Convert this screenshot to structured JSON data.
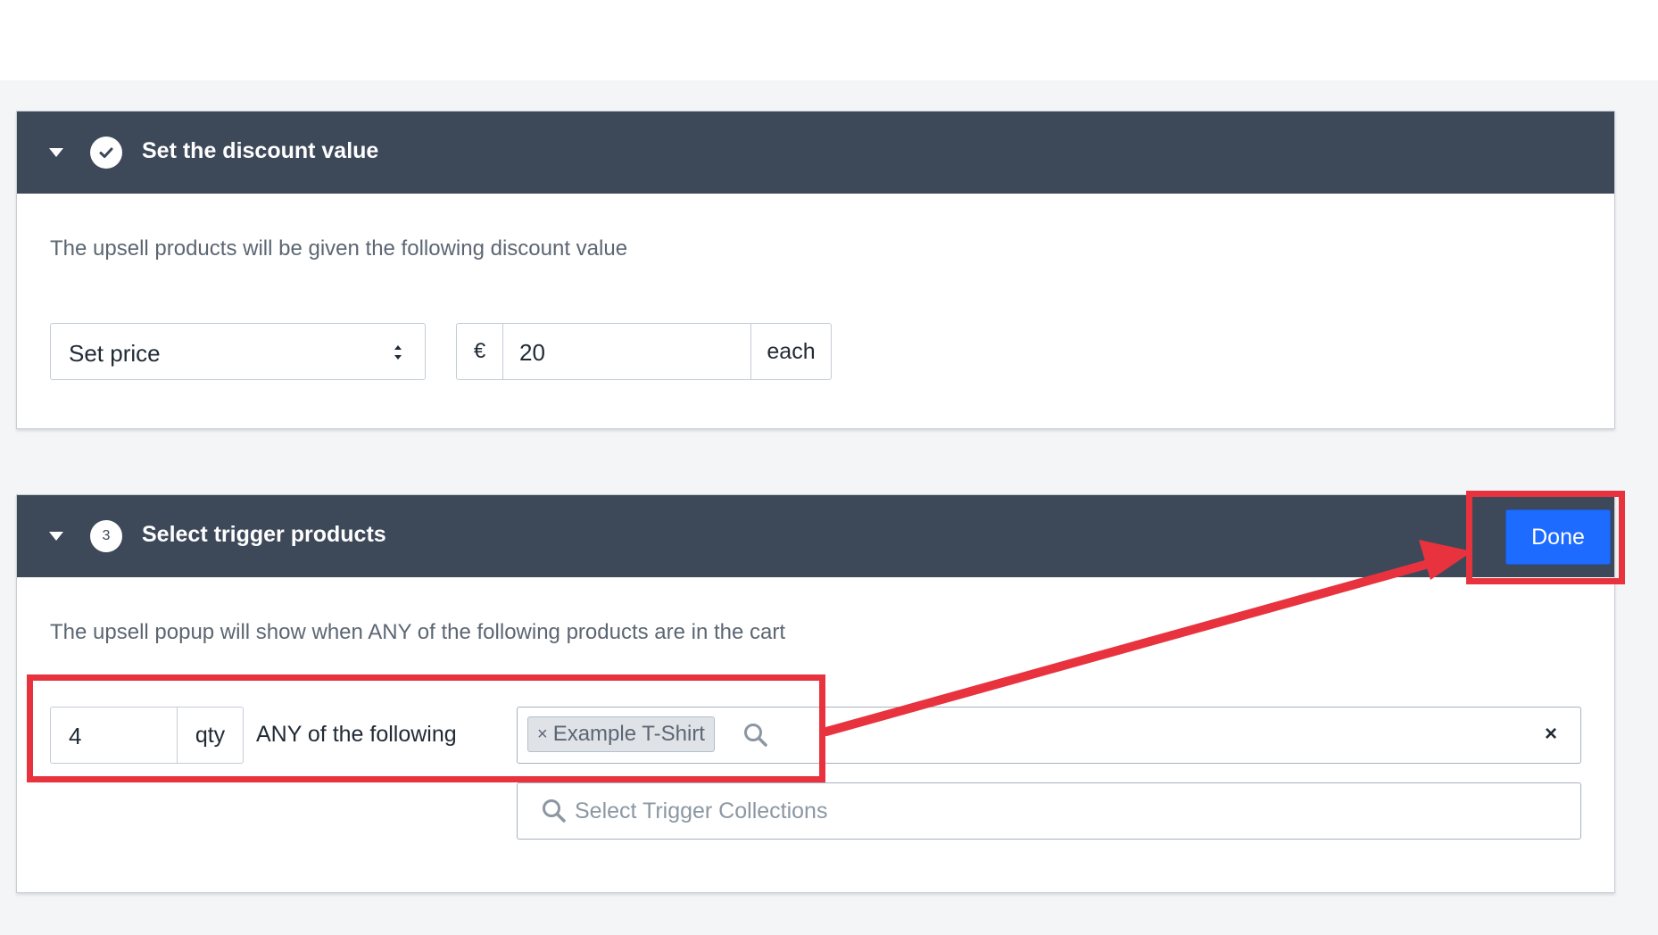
{
  "section_discount": {
    "title": "Set the discount value",
    "description": "The upsell products will be given the following discount value",
    "discount_type": "Set price",
    "currency_symbol": "€",
    "amount": "20",
    "amount_suffix": "each"
  },
  "section_trigger": {
    "step_number": "3",
    "title": "Select trigger products",
    "done_label": "Done",
    "description": "The upsell popup will show when ANY of the following products are in the cart",
    "quantity": "4",
    "quantity_suffix": "qty",
    "match_label": "ANY of the following",
    "selected_tag": "Example T-Shirt",
    "tag_remove": "×",
    "clear_label": "×",
    "collections_placeholder": "Select Trigger Collections"
  },
  "icons": {
    "collapse": "caret-down-icon",
    "completed": "checkmark-circle-icon",
    "search": "search-icon",
    "select_arrows": "select-arrows-icon"
  },
  "colors": {
    "header_bg": "#3d4859",
    "primary_button": "#1e6bff",
    "annotation": "#e8333f",
    "page_bg": "#f4f5f7"
  }
}
